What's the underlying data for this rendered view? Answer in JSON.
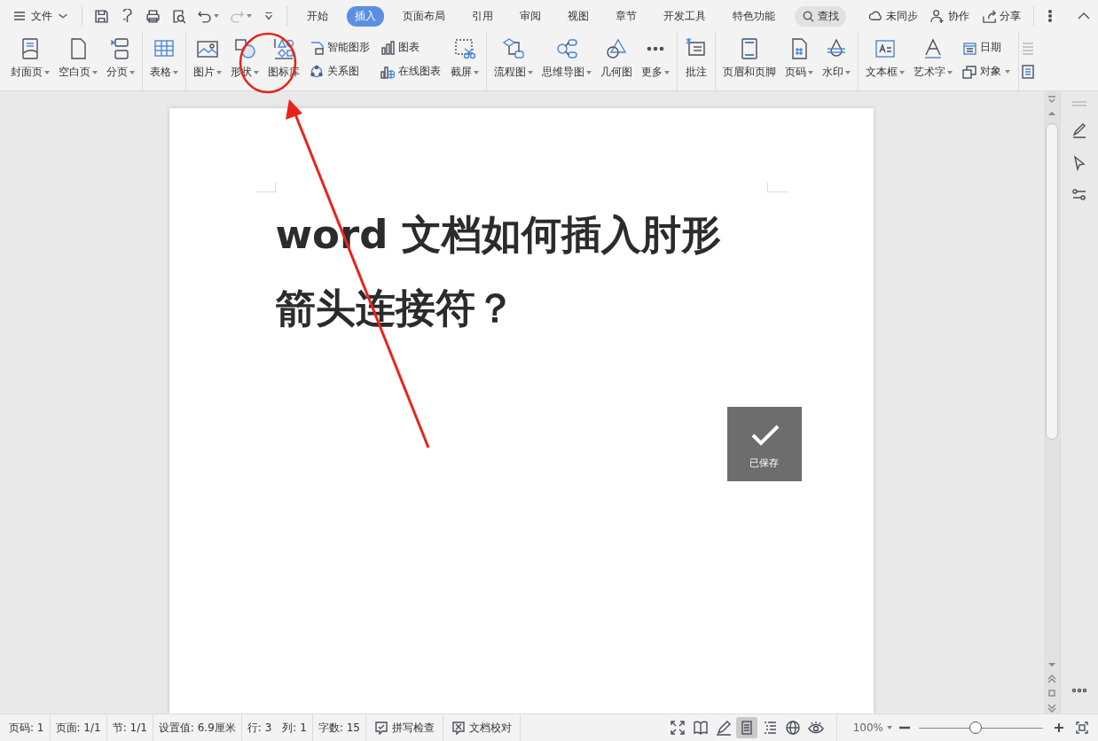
{
  "menu": {
    "label": "文件"
  },
  "tabs": [
    {
      "label": "开始",
      "selected": false
    },
    {
      "label": "插入",
      "selected": true
    },
    {
      "label": "页面布局",
      "selected": false
    },
    {
      "label": "引用",
      "selected": false
    },
    {
      "label": "审阅",
      "selected": false
    },
    {
      "label": "视图",
      "selected": false
    },
    {
      "label": "章节",
      "selected": false
    },
    {
      "label": "开发工具",
      "selected": false
    },
    {
      "label": "特色功能",
      "selected": false
    }
  ],
  "search": {
    "label": "查找"
  },
  "account_actions": [
    "未同步",
    "协作",
    "分享"
  ],
  "ribbon": {
    "groups": [
      {
        "items": [
          {
            "kind": "large",
            "label": "封面页",
            "dropdown": true
          },
          {
            "kind": "large",
            "label": "空白页",
            "dropdown": true
          },
          {
            "kind": "large",
            "label": "分页",
            "dropdown": true
          }
        ]
      },
      {
        "items": [
          {
            "kind": "large",
            "label": "表格",
            "dropdown": true
          }
        ]
      },
      {
        "items": [
          {
            "kind": "large",
            "label": "图片",
            "dropdown": true
          },
          {
            "kind": "large",
            "label": "形状",
            "dropdown": true
          },
          {
            "kind": "large",
            "label": "图标库",
            "dropdown": false
          },
          {
            "kind": "stack",
            "entries": [
              {
                "label": "智能图形",
                "dropdown": false
              },
              {
                "label": "关系图",
                "dropdown": false
              }
            ]
          },
          {
            "kind": "stack",
            "entries": [
              {
                "label": "图表",
                "dropdown": false
              },
              {
                "label": "在线图表",
                "dropdown": false
              }
            ]
          },
          {
            "kind": "large",
            "label": "截屏",
            "dropdown": true
          }
        ]
      },
      {
        "items": [
          {
            "kind": "large",
            "label": "流程图",
            "dropdown": true
          },
          {
            "kind": "large",
            "label": "思维导图",
            "dropdown": true
          },
          {
            "kind": "large",
            "label": "几何图",
            "dropdown": false
          },
          {
            "kind": "large",
            "label": "更多",
            "dropdown": true
          }
        ]
      },
      {
        "items": [
          {
            "kind": "large",
            "label": "批注",
            "dropdown": false
          }
        ]
      },
      {
        "items": [
          {
            "kind": "large",
            "label": "页眉和页脚",
            "dropdown": false
          },
          {
            "kind": "large",
            "label": "页码",
            "dropdown": true
          },
          {
            "kind": "large",
            "label": "水印",
            "dropdown": true
          }
        ]
      },
      {
        "items": [
          {
            "kind": "large",
            "label": "文本框",
            "dropdown": true
          },
          {
            "kind": "large",
            "label": "艺术字",
            "dropdown": true
          },
          {
            "kind": "stack",
            "entries": [
              {
                "label": "日期",
                "dropdown": false
              },
              {
                "label": "对象",
                "dropdown": true
              }
            ]
          }
        ]
      }
    ]
  },
  "document": {
    "title_lines": [
      "word 文档如何插入肘形",
      "箭头连接符？"
    ]
  },
  "save_toast": {
    "label": "已保存"
  },
  "status_bar": {
    "fields": [
      "页码: 1",
      "页面: 1/1",
      "节: 1/1",
      "设置值: 6.9厘米",
      "行: 3",
      "列: 1",
      "字数: 15"
    ],
    "buttons": [
      "拼写检查",
      "文档校对"
    ],
    "view_modes": [
      {
        "selected": false
      },
      {
        "selected": false
      },
      {
        "selected": false
      },
      {
        "selected": true
      },
      {
        "selected": false
      },
      {
        "selected": false
      },
      {
        "selected": false
      }
    ],
    "zoom": {
      "reading": "100%",
      "level": 0.46
    }
  }
}
